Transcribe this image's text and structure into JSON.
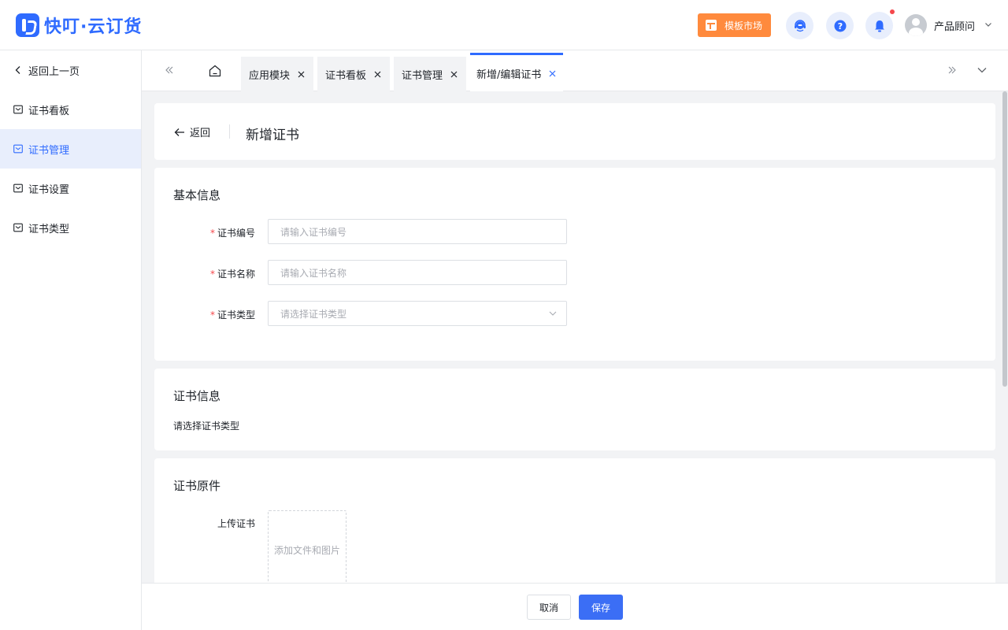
{
  "app": {
    "brand": "快叮·云订货",
    "brand_color": "#2f6bff"
  },
  "header": {
    "template_market_label": "模板市场",
    "user_name": "产品顾问",
    "icons": [
      "customer-service-icon",
      "help-icon",
      "bell-icon"
    ]
  },
  "sidebar": {
    "back_label": "返回上一页",
    "items": [
      {
        "label": "证书看板",
        "active": false
      },
      {
        "label": "证书管理",
        "active": true
      },
      {
        "label": "证书设置",
        "active": false
      },
      {
        "label": "证书类型",
        "active": false
      }
    ]
  },
  "tabs": [
    {
      "label": "应用模块",
      "active": false
    },
    {
      "label": "证书看板",
      "active": false
    },
    {
      "label": "证书管理",
      "active": false
    },
    {
      "label": "新增/编辑证书",
      "active": true
    }
  ],
  "page": {
    "back_label": "返回",
    "title": "新增证书"
  },
  "basic_info": {
    "title": "基本信息",
    "fields": [
      {
        "label": "证书编号",
        "required": true,
        "placeholder": "请输入证书编号",
        "type": "input"
      },
      {
        "label": "证书名称",
        "required": true,
        "placeholder": "请输入证书名称",
        "type": "input"
      },
      {
        "label": "证书类型",
        "required": true,
        "placeholder": "请选择证书类型",
        "type": "select"
      }
    ]
  },
  "cert_info": {
    "title": "证书信息",
    "hint": "请选择证书类型"
  },
  "cert_original": {
    "title": "证书原件",
    "upload_label": "上传证书",
    "upload_placeholder": "添加文件和图片"
  },
  "footer": {
    "cancel_label": "取消",
    "save_label": "保存"
  },
  "colors": {
    "accent": "#2f6bff",
    "market": "#ff8a3d",
    "required": "#f5474c"
  }
}
